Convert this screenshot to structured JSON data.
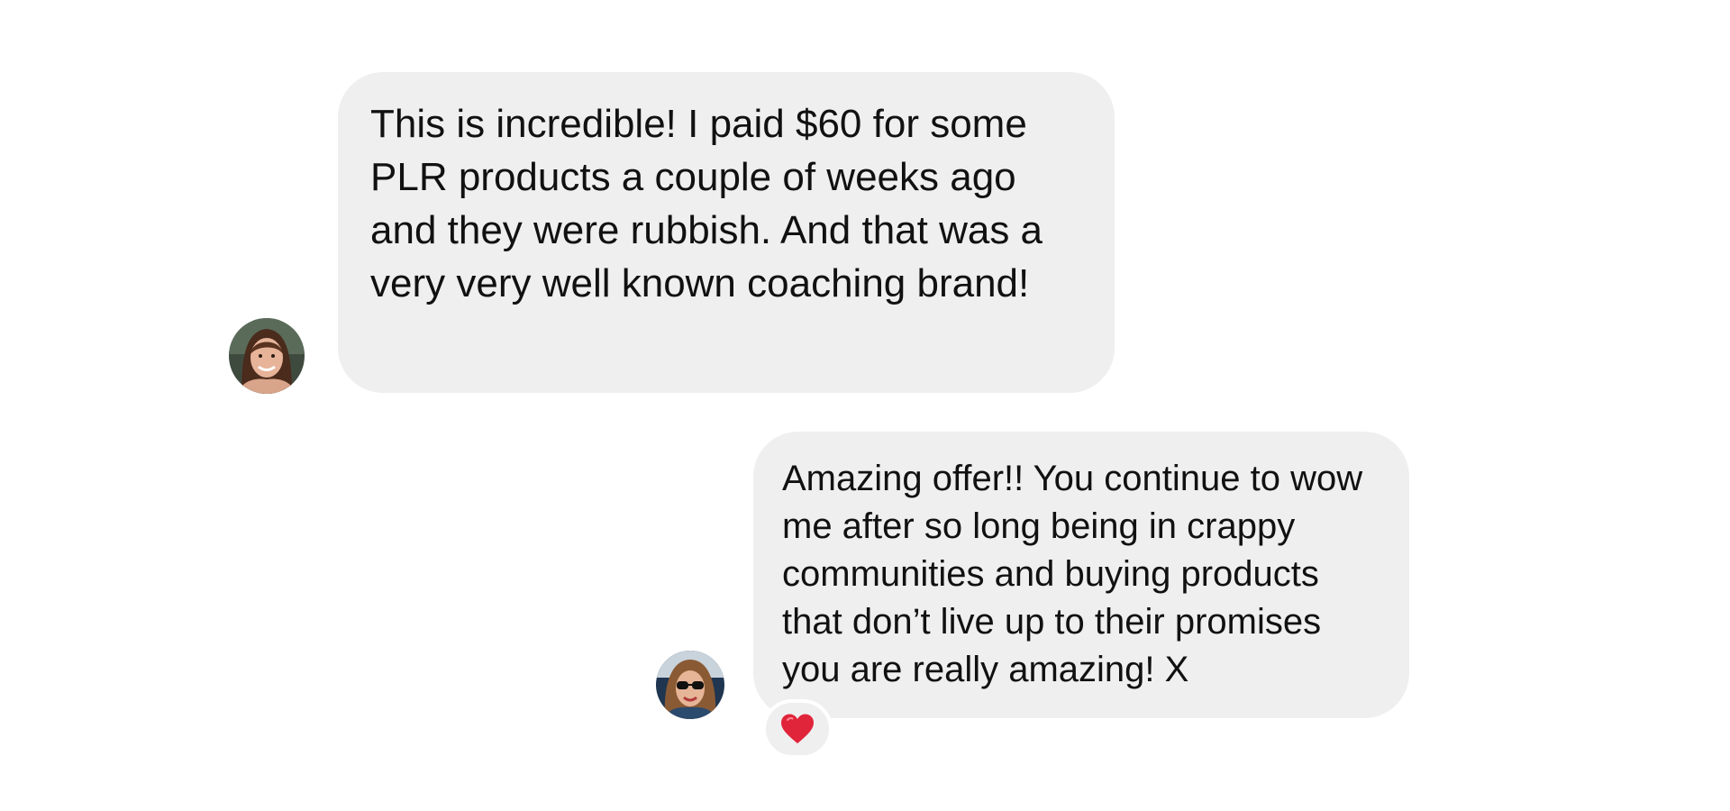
{
  "conversation": {
    "messages": [
      {
        "text": "This is incredible! I paid $60 for some PLR products a couple of weeks ago and they were rubbish. And that was a very very well known coaching brand!",
        "avatar_icon": "user-avatar-woman-brown-hair"
      },
      {
        "text": "Amazing offer!! You continue to wow me after so long being in crappy communities and buying products that don’t live up to their promises you are really amazing! X",
        "avatar_icon": "user-avatar-woman-sunglasses",
        "reaction": "❤️",
        "reaction_icon": "heart-reaction-icon"
      }
    ]
  },
  "colors": {
    "bubble_bg": "#efefef",
    "text": "#111111",
    "page_bg": "#ffffff",
    "reaction_heart": "#e0243a"
  }
}
